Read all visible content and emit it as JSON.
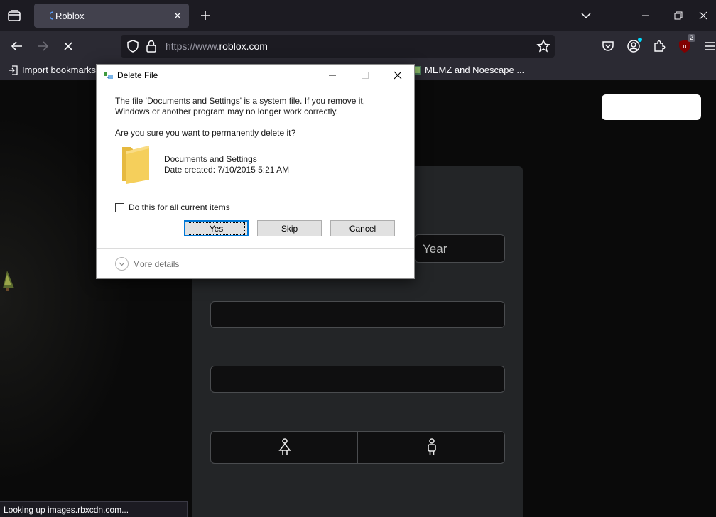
{
  "browser": {
    "tab": {
      "title": "Roblox"
    },
    "url": {
      "protocol": "https://www.",
      "host": "roblox.com"
    },
    "toolbar": {
      "extensions_badge": "2"
    },
    "bookmarks": [
      {
        "label": "Import bookmarks..."
      },
      {
        "label": "MEMZ and Noescape ..."
      }
    ],
    "status": "Looking up images.rbxcdn.com..."
  },
  "page": {
    "year_placeholder": "Year"
  },
  "dialog": {
    "title": "Delete File",
    "message_line1": "The file 'Documents and Settings' is a system file. If you remove it,",
    "message_line2": "Windows or another program may no longer work correctly.",
    "question": "Are you sure you want to permanently delete it?",
    "file_name": "Documents and Settings",
    "file_date": "Date created: 7/10/2015 5:21 AM",
    "checkbox_label": "Do this for all current items",
    "checkbox_checked": false,
    "buttons": {
      "yes": "Yes",
      "skip": "Skip",
      "cancel": "Cancel"
    },
    "more_details": "More details"
  },
  "colors": {
    "browser_chrome": "#1c1b22",
    "toolbar": "#2b2a33",
    "card": "#232527",
    "button_focus": "#0078d7",
    "folder_yellow": "#f5cf5b"
  }
}
